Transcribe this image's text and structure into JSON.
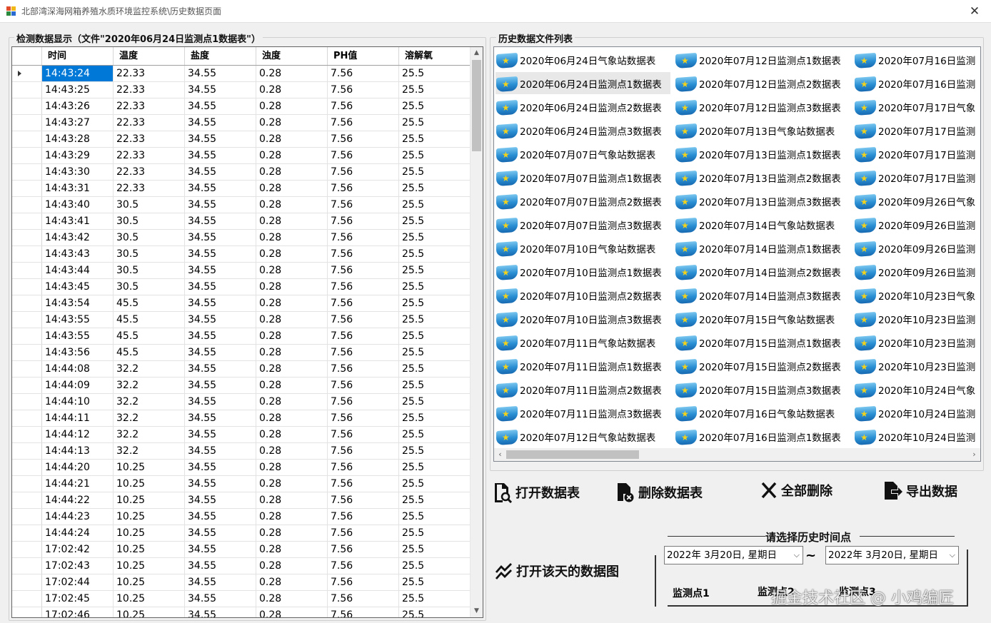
{
  "window": {
    "title": "北部湾深海网箱养殖水质环境监控系统\\历史数据页面",
    "close_glyph": "✕"
  },
  "data_group": {
    "title": "检测数据显示（文件\"2020年06月24日监测点1数据表\"）"
  },
  "grid": {
    "columns": [
      "时间",
      "温度",
      "盐度",
      "浊度",
      "PH值",
      "溶解氧"
    ],
    "rows": [
      [
        "14:43:24",
        "22.33",
        "34.55",
        "0.28",
        "7.56",
        "25.5"
      ],
      [
        "14:43:25",
        "22.33",
        "34.55",
        "0.28",
        "7.56",
        "25.5"
      ],
      [
        "14:43:26",
        "22.33",
        "34.55",
        "0.28",
        "7.56",
        "25.5"
      ],
      [
        "14:43:27",
        "22.33",
        "34.55",
        "0.28",
        "7.56",
        "25.5"
      ],
      [
        "14:43:28",
        "22.33",
        "34.55",
        "0.28",
        "7.56",
        "25.5"
      ],
      [
        "14:43:29",
        "22.33",
        "34.55",
        "0.28",
        "7.56",
        "25.5"
      ],
      [
        "14:43:30",
        "22.33",
        "34.55",
        "0.28",
        "7.56",
        "25.5"
      ],
      [
        "14:43:31",
        "22.33",
        "34.55",
        "0.28",
        "7.56",
        "25.5"
      ],
      [
        "14:43:40",
        "30.5",
        "34.55",
        "0.28",
        "7.56",
        "25.5"
      ],
      [
        "14:43:41",
        "30.5",
        "34.55",
        "0.28",
        "7.56",
        "25.5"
      ],
      [
        "14:43:42",
        "30.5",
        "34.55",
        "0.28",
        "7.56",
        "25.5"
      ],
      [
        "14:43:43",
        "30.5",
        "34.55",
        "0.28",
        "7.56",
        "25.5"
      ],
      [
        "14:43:44",
        "30.5",
        "34.55",
        "0.28",
        "7.56",
        "25.5"
      ],
      [
        "14:43:45",
        "30.5",
        "34.55",
        "0.28",
        "7.56",
        "25.5"
      ],
      [
        "14:43:54",
        "45.5",
        "34.55",
        "0.28",
        "7.56",
        "25.5"
      ],
      [
        "14:43:55",
        "45.5",
        "34.55",
        "0.28",
        "7.56",
        "25.5"
      ],
      [
        "14:43:55",
        "45.5",
        "34.55",
        "0.28",
        "7.56",
        "25.5"
      ],
      [
        "14:43:56",
        "45.5",
        "34.55",
        "0.28",
        "7.56",
        "25.5"
      ],
      [
        "14:44:08",
        "32.2",
        "34.55",
        "0.28",
        "7.56",
        "25.5"
      ],
      [
        "14:44:09",
        "32.2",
        "34.55",
        "0.28",
        "7.56",
        "25.5"
      ],
      [
        "14:44:10",
        "32.2",
        "34.55",
        "0.28",
        "7.56",
        "25.5"
      ],
      [
        "14:44:11",
        "32.2",
        "34.55",
        "0.28",
        "7.56",
        "25.5"
      ],
      [
        "14:44:12",
        "32.2",
        "34.55",
        "0.28",
        "7.56",
        "25.5"
      ],
      [
        "14:44:13",
        "32.2",
        "34.55",
        "0.28",
        "7.56",
        "25.5"
      ],
      [
        "14:44:20",
        "10.25",
        "34.55",
        "0.28",
        "7.56",
        "25.5"
      ],
      [
        "14:44:21",
        "10.25",
        "34.55",
        "0.28",
        "7.56",
        "25.5"
      ],
      [
        "14:44:22",
        "10.25",
        "34.55",
        "0.28",
        "7.56",
        "25.5"
      ],
      [
        "14:44:23",
        "10.25",
        "34.55",
        "0.28",
        "7.56",
        "25.5"
      ],
      [
        "14:44:24",
        "10.25",
        "34.55",
        "0.28",
        "7.56",
        "25.5"
      ],
      [
        "17:02:42",
        "10.25",
        "34.55",
        "0.28",
        "7.56",
        "25.5"
      ],
      [
        "17:02:43",
        "10.25",
        "34.55",
        "0.28",
        "7.56",
        "25.5"
      ],
      [
        "17:02:44",
        "10.25",
        "34.55",
        "0.28",
        "7.56",
        "25.5"
      ],
      [
        "17:02:45",
        "10.25",
        "34.55",
        "0.28",
        "7.56",
        "25.5"
      ],
      [
        "17:02:46",
        "10.25",
        "34.55",
        "0.28",
        "7.56",
        "25.5"
      ]
    ],
    "selected_row": 0
  },
  "files_group": {
    "title": "历史数据文件列表",
    "columns": [
      [
        "2020年06月24日气象站数据表",
        "2020年06月24日监测点1数据表",
        "2020年06月24日监测点2数据表",
        "2020年06月24日监测点3数据表",
        "2020年07月07日气象站数据表",
        "2020年07月07日监测点1数据表",
        "2020年07月07日监测点2数据表",
        "2020年07月07日监测点3数据表",
        "2020年07月10日气象站数据表",
        "2020年07月10日监测点1数据表",
        "2020年07月10日监测点2数据表",
        "2020年07月10日监测点3数据表",
        "2020年07月11日气象站数据表",
        "2020年07月11日监测点1数据表",
        "2020年07月11日监测点2数据表",
        "2020年07月11日监测点3数据表",
        "2020年07月12日气象站数据表"
      ],
      [
        "2020年07月12日监测点1数据表",
        "2020年07月12日监测点2数据表",
        "2020年07月12日监测点3数据表",
        "2020年07月13日气象站数据表",
        "2020年07月13日监测点1数据表",
        "2020年07月13日监测点2数据表",
        "2020年07月13日监测点3数据表",
        "2020年07月14日气象站数据表",
        "2020年07月14日监测点1数据表",
        "2020年07月14日监测点2数据表",
        "2020年07月14日监测点3数据表",
        "2020年07月15日气象站数据表",
        "2020年07月15日监测点1数据表",
        "2020年07月15日监测点2数据表",
        "2020年07月15日监测点3数据表",
        "2020年07月16日气象站数据表",
        "2020年07月16日监测点1数据表"
      ],
      [
        "2020年07月16日监测",
        "2020年07月16日监测",
        "2020年07月17日气象",
        "2020年07月17日监测",
        "2020年07月17日监测",
        "2020年07月17日监测",
        "2020年09月26日气象",
        "2020年09月26日监测",
        "2020年09月26日监测",
        "2020年09月26日监测",
        "2020年10月23日气象",
        "2020年10月23日监测",
        "2020年10月23日监测",
        "2020年10月23日监测",
        "2020年10月24日气象",
        "2020年10月24日监测",
        "2020年10月24日监测"
      ]
    ],
    "highlighted": "2020年06月24日监测点1数据表"
  },
  "buttons": {
    "open_table": "打开数据表",
    "delete_table": "删除数据表",
    "delete_all": "全部删除",
    "export": "导出数据",
    "open_chart": "打开该天的数据图"
  },
  "time_select": {
    "legend": "请选择历史时间点",
    "start_date": "2022年  3月20日, 星期日",
    "end_date": "2022年  3月20日, 星期日",
    "separator": "~",
    "points": [
      "监测点1",
      "监测点2",
      "监测点3"
    ]
  },
  "watermark": "掘金技术社区 @ 小鸡编匠"
}
